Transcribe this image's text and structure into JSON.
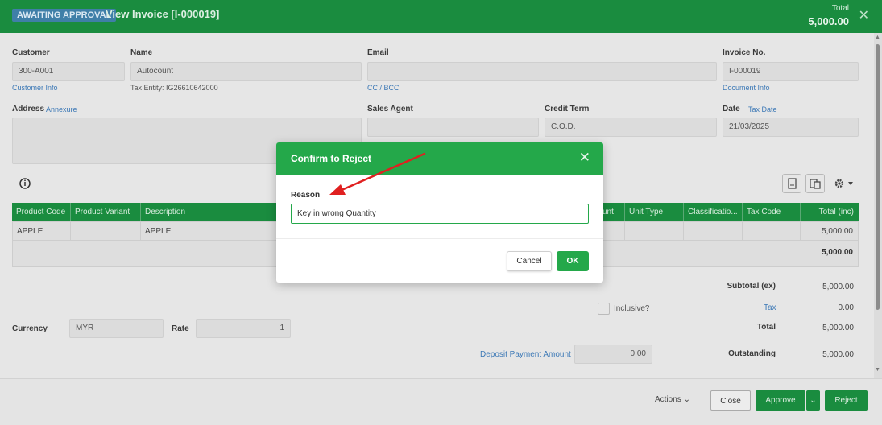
{
  "header": {
    "status_badge": "AWAITING APPROVAL",
    "title": "View Invoice [I-000019]",
    "total_label": "Total",
    "total_value": "5,000.00"
  },
  "form": {
    "customer_label": "Customer",
    "customer_value": "300-A001",
    "customer_info_link": "Customer Info",
    "name_label": "Name",
    "name_value": "Autocount",
    "tax_entity": "Tax Entity: IG26610642000",
    "email_label": "Email",
    "cc_bcc_link": "CC / BCC",
    "invoice_no_label": "Invoice No.",
    "invoice_no_value": "I-000019",
    "document_info_link": "Document Info",
    "address_label": "Address",
    "annexure_link": "Annexure",
    "sales_agent_label": "Sales Agent",
    "credit_term_label": "Credit Term",
    "credit_term_value": "C.O.D.",
    "date_label": "Date",
    "tax_date_link": "Tax Date",
    "date_value": "21/03/2025"
  },
  "grid": {
    "columns": [
      "Product Code",
      "Product Variant",
      "Description",
      "unt",
      "Unit Type",
      "Classificatio...",
      "Tax Code",
      "Total (inc)"
    ],
    "rows": [
      {
        "product_code": "APPLE",
        "product_variant": "",
        "description": "APPLE",
        "total": "5,000.00"
      }
    ],
    "footer_total": "5,000.00"
  },
  "summary": {
    "subtotal_label": "Subtotal (ex)",
    "subtotal_value": "5,000.00",
    "inclusive_label": "Inclusive?",
    "tax_label": "Tax",
    "tax_value": "0.00",
    "total_label": "Total",
    "total_value": "5,000.00",
    "currency_label": "Currency",
    "currency_value": "MYR",
    "rate_label": "Rate",
    "rate_value": "1",
    "deposit_label": "Deposit Payment Amount",
    "deposit_value": "0.00",
    "outstanding_label": "Outstanding",
    "outstanding_value": "5,000.00"
  },
  "footer": {
    "actions_label": "Actions",
    "close_label": "Close",
    "approve_label": "Approve",
    "reject_label": "Reject"
  },
  "modal": {
    "title": "Confirm to Reject",
    "reason_label": "Reason",
    "reason_value": "Key in wrong Quantity",
    "cancel_label": "Cancel",
    "ok_label": "OK"
  },
  "colors": {
    "primary_green": "#1a8c3f",
    "modal_green": "#24a84a",
    "link_blue": "#3d79b6",
    "arrow_red": "#e02020"
  },
  "icons": {
    "header_close": "close-icon",
    "info": "info-icon",
    "pdf": "pdf-icon",
    "copy": "copy-icon",
    "settings": "gear-icon",
    "modal_close": "close-icon",
    "annotation": "red-arrow"
  }
}
